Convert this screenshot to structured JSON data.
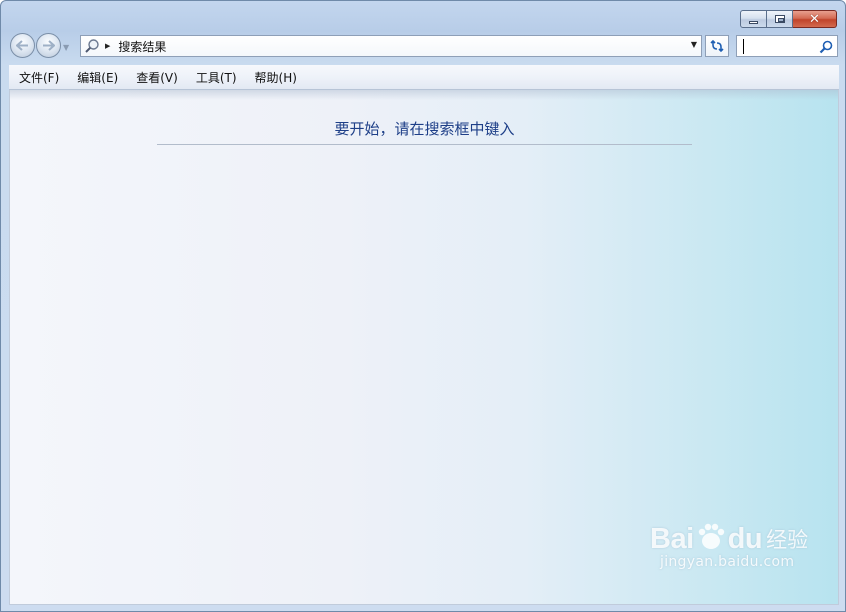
{
  "window": {
    "caption_buttons": [
      "minimize",
      "maximize",
      "close"
    ],
    "close_color": "#c1442a"
  },
  "navigation": {
    "back_icon": "back-arrow-icon",
    "forward_icon": "forward-arrow-icon"
  },
  "address_bar": {
    "icon": "magnifier-icon",
    "path": "搜索结果"
  },
  "search": {
    "value": "",
    "placeholder": ""
  },
  "menu": {
    "items": [
      {
        "label": "文件(F)"
      },
      {
        "label": "编辑(E)"
      },
      {
        "label": "查看(V)"
      },
      {
        "label": "工具(T)"
      },
      {
        "label": "帮助(H)"
      }
    ]
  },
  "content": {
    "prompt": "要开始，请在搜索框中键入",
    "prompt_color": "#1e3f88"
  },
  "watermark": {
    "brand_left": "Bai",
    "brand_right": "du",
    "label_cn": "经验",
    "url": "jingyan.baidu.com"
  }
}
